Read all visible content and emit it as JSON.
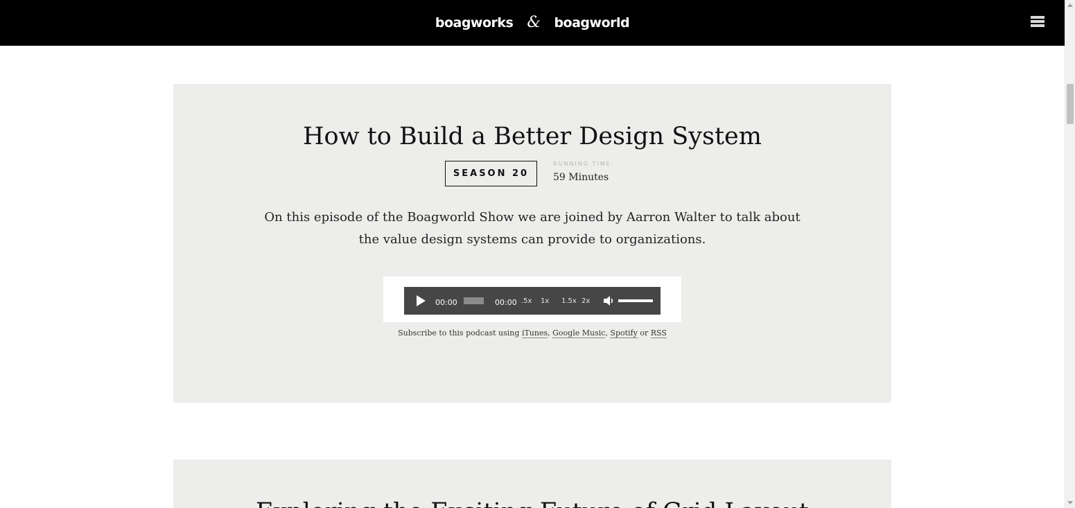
{
  "header": {
    "logo_left": "boagworks",
    "logo_amp": "&",
    "logo_right": "boagworld"
  },
  "episodes": [
    {
      "title": "How to Build a Better Design System",
      "season_label": "SEASON 20",
      "running_time_label": "RUNNING TIME:",
      "running_time_value": "59 Minutes",
      "description": "On this episode of the Boagworld Show we are joined by Aarron Walter to talk about the value design systems can provide to organizations.",
      "player": {
        "current_time": "00:00",
        "total_time": "00:00",
        "speeds": [
          ".5x",
          "1x",
          "1.5x",
          "2x"
        ],
        "volume_level": 1.0
      },
      "subscribe": {
        "prefix": "Subscribe to this podcast using",
        "links": [
          "iTunes",
          "Google Music",
          "Spotify",
          "RSS"
        ],
        "separator": ",",
        "or": "or"
      }
    },
    {
      "title": "Exploring the Exciting Future of Grid Layout"
    }
  ]
}
